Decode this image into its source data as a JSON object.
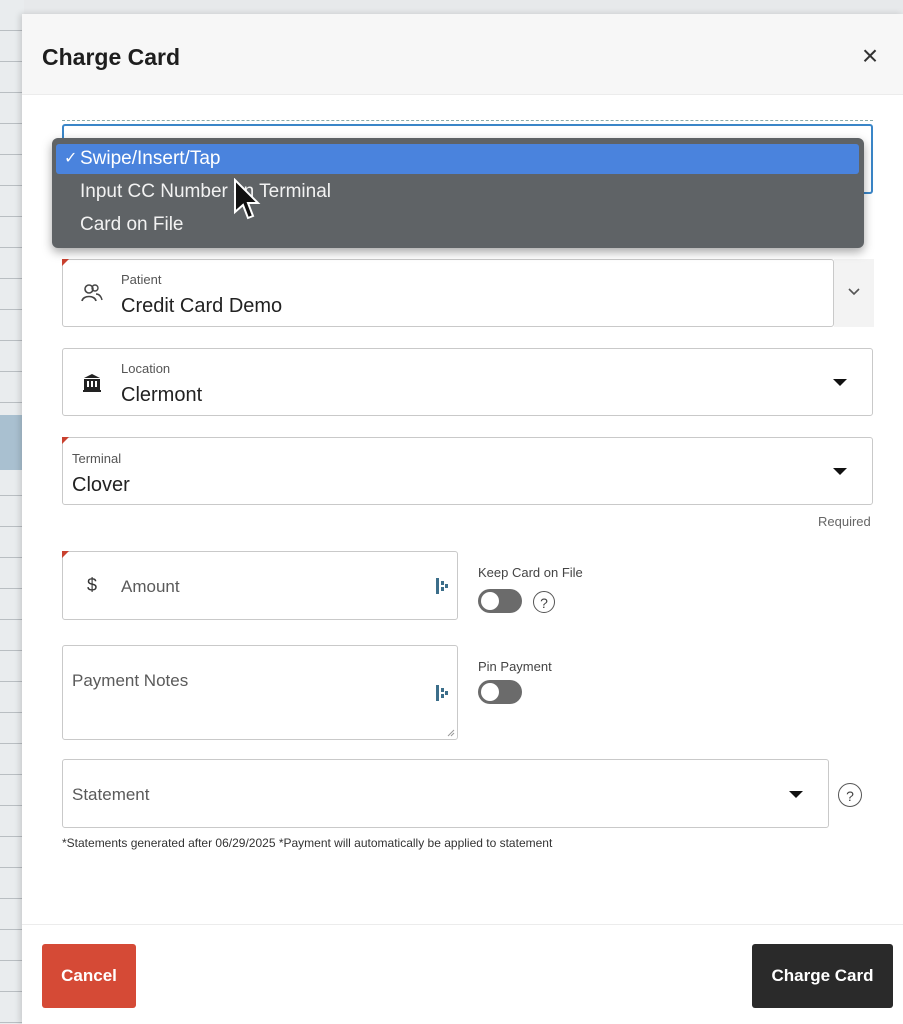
{
  "dialog": {
    "title": "Charge Card",
    "close_label": "×"
  },
  "payment_method": {
    "options": [
      {
        "label": "Swipe/Insert/Tap",
        "selected": true
      },
      {
        "label": "Input CC Number on Terminal",
        "selected": false
      },
      {
        "label": "Card on File",
        "selected": false
      }
    ],
    "check": "✓"
  },
  "patient": {
    "label": "Patient",
    "value": "Credit Card Demo"
  },
  "location": {
    "label": "Location",
    "value": "Clermont"
  },
  "terminal": {
    "label": "Terminal",
    "value": "Clover",
    "required_note": "Required"
  },
  "amount": {
    "currency_symbol": "$",
    "placeholder": "Amount"
  },
  "keep_card": {
    "label": "Keep Card on File",
    "help": "?"
  },
  "notes": {
    "placeholder": "Payment Notes"
  },
  "pin_payment": {
    "label": "Pin Payment"
  },
  "statement": {
    "placeholder": "Statement",
    "help": "?",
    "note": "*Statements generated after 06/29/2025 *Payment will automatically be applied to statement"
  },
  "buttons": {
    "cancel": "Cancel",
    "charge": "Charge Card"
  },
  "colors": {
    "cancel": "#d54a36",
    "charge": "#2a2a2a",
    "selected_option": "#4a83dd",
    "required": "#c9412f"
  }
}
